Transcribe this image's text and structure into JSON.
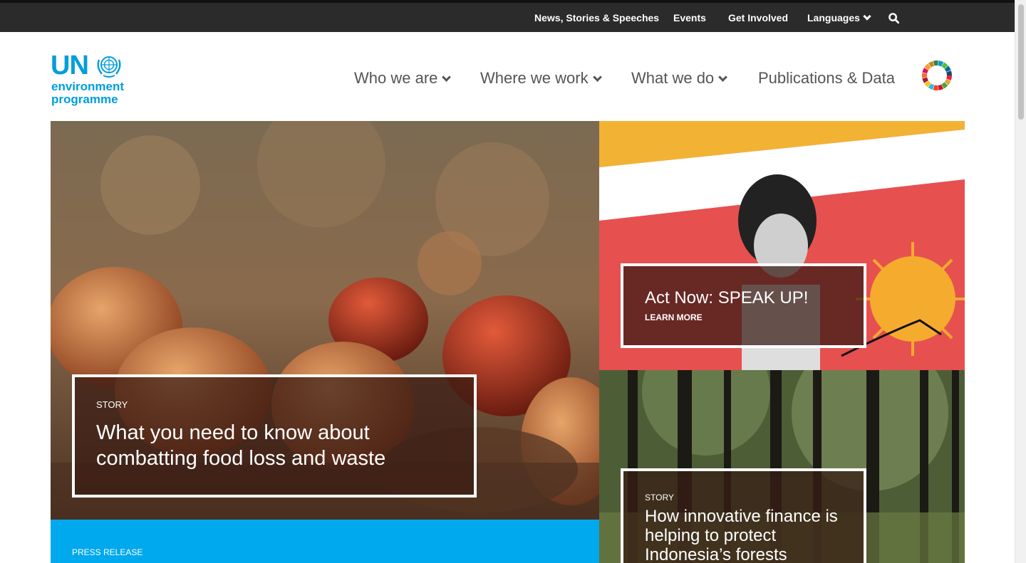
{
  "topbar": {
    "items": [
      "News, Stories & Speeches",
      "Events",
      "Get Involved",
      "Languages"
    ],
    "search_icon": "search-icon"
  },
  "logo": {
    "line1": "UN",
    "line2": "environment",
    "line3": "programme"
  },
  "nav": {
    "items": [
      "Who we are",
      "Where we work",
      "What we do",
      "Publications & Data"
    ]
  },
  "hero": {
    "kicker": "STORY",
    "title": "What you need to know about combatting food loss and waste"
  },
  "promo": {
    "title": "Act Now: SPEAK UP!",
    "link": "LEARN MORE"
  },
  "story2": {
    "kicker": "STORY",
    "title": "How innovative finance is helping to protect Indonesia’s forests"
  },
  "press": {
    "kicker": "PRESS RELEASE"
  },
  "colors": {
    "brand_blue": "#009edb",
    "topbar": "#2b2b2b",
    "press_blue": "#00a8ee"
  }
}
